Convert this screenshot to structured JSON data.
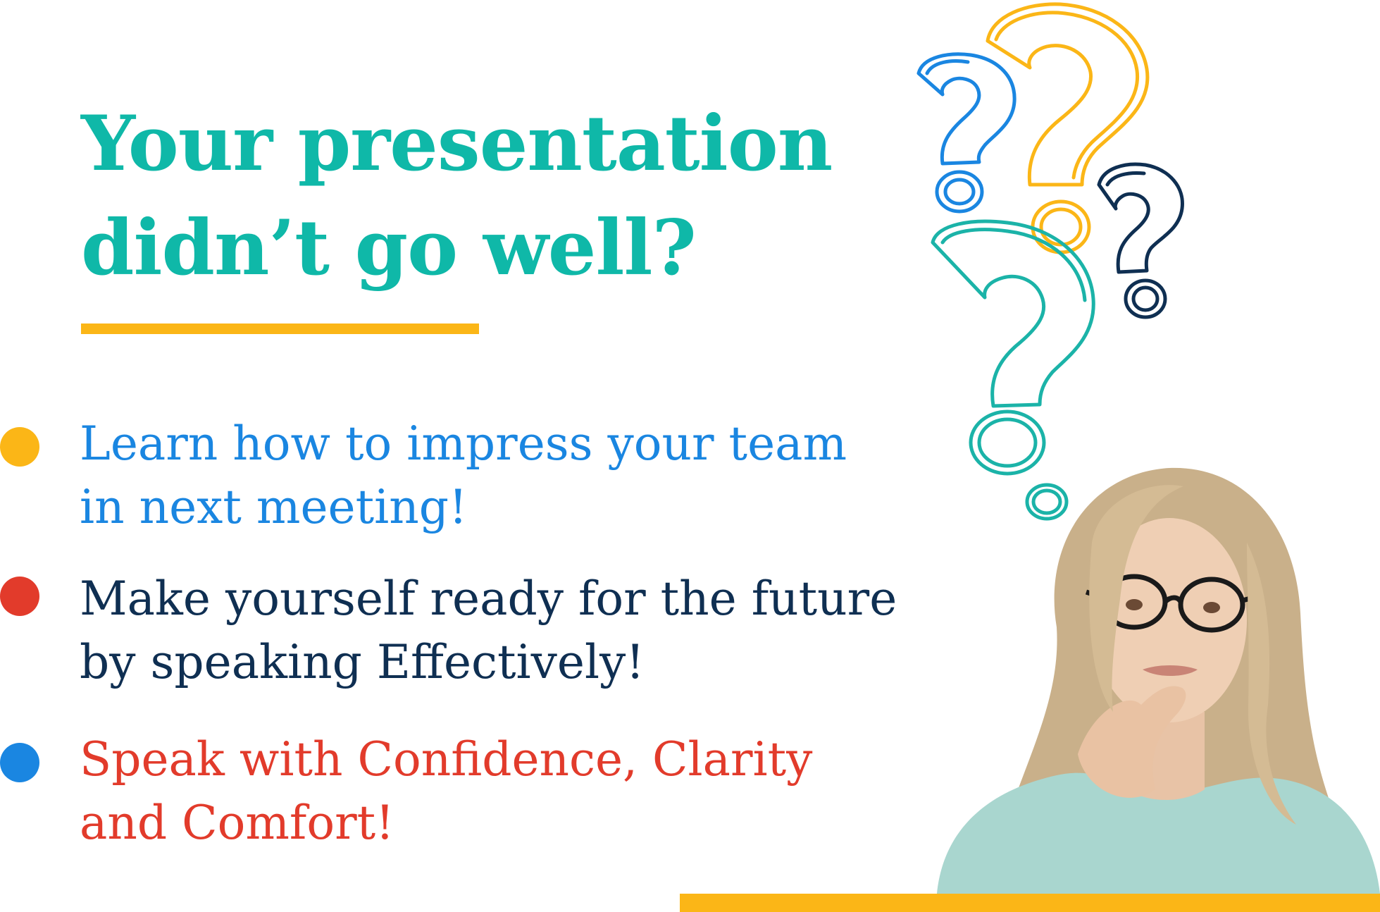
{
  "headline": {
    "line1": "Your presentation",
    "line2": "didn’t go well?"
  },
  "bullets": [
    {
      "line1": "Learn how to impress your team",
      "line2": "in next meeting!"
    },
    {
      "line1": "Make yourself ready for the future",
      "line2": "by speaking Effectively!"
    },
    {
      "line1": "Speak with Confidence, Clarity",
      "line2": "and Comfort!"
    }
  ],
  "colors": {
    "headline": "#0fb8a8",
    "accent_yellow": "#fbb617",
    "bullet1_text": "#1a86e1",
    "bullet2_text": "#0f2f52",
    "bullet3_text": "#e23b2b",
    "dot1": "#fbb617",
    "dot2": "#e23b2b",
    "dot3": "#1a86e1",
    "qmark_blue": "#1a86e1",
    "qmark_yellow": "#fbb617",
    "qmark_navy": "#0f2f52",
    "qmark_teal": "#1bb3a8"
  },
  "icons": {
    "decoration": "question-mark-icon",
    "illustration": "thinking-woman-photo"
  }
}
